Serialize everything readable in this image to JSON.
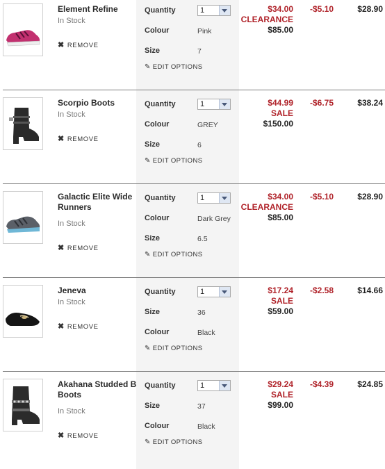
{
  "colors": {
    "sale_red": "#b0232a",
    "band_gray": "#f4f4f4"
  },
  "remove_label": "REMOVE",
  "edit_label": "EDIT OPTIONS",
  "items": [
    {
      "name": "Element Refine",
      "stock": "In Stock",
      "thumbnail": "pink-running-shoe",
      "detail1_label": "Colour",
      "detail1_value": "Pink",
      "detail2_label": "Size",
      "detail2_value": "7",
      "quantity_label": "Quantity",
      "quantity": "1",
      "sale_price": "$34.00",
      "sale_tag": "CLEARANCE",
      "original_price": "$85.00",
      "discount": "-$5.10",
      "total": "$28.90"
    },
    {
      "name": "Scorpio Boots",
      "stock": "In Stock",
      "thumbnail": "black-ankle-boot",
      "detail1_label": "Colour",
      "detail1_value": "GREY",
      "detail2_label": "Size",
      "detail2_value": "6",
      "quantity_label": "Quantity",
      "quantity": "1",
      "sale_price": "$44.99",
      "sale_tag": "SALE",
      "original_price": "$150.00",
      "discount": "-$6.75",
      "total": "$38.24"
    },
    {
      "name": "Galactic Elite Wide Runners",
      "stock": "In Stock",
      "thumbnail": "grey-running-shoe",
      "detail1_label": "Colour",
      "detail1_value": "Dark Grey",
      "detail2_label": "Size",
      "detail2_value": "6.5",
      "quantity_label": "Quantity",
      "quantity": "1",
      "sale_price": "$34.00",
      "sale_tag": "CLEARANCE",
      "original_price": "$85.00",
      "discount": "-$5.10",
      "total": "$28.90"
    },
    {
      "name": "Jeneva",
      "stock": "In Stock",
      "thumbnail": "black-flat-shoe",
      "detail1_label": "Size",
      "detail1_value": "36",
      "detail2_label": "Colour",
      "detail2_value": "Black",
      "quantity_label": "Quantity",
      "quantity": "1",
      "sale_price": "$17.24",
      "sale_tag": "SALE",
      "original_price": "$59.00",
      "discount": "-$2.58",
      "total": "$14.66"
    },
    {
      "name": "Akahana Studded B Boots",
      "stock": "In Stock",
      "thumbnail": "black-studded-boot",
      "detail1_label": "Size",
      "detail1_value": "37",
      "detail2_label": "Colour",
      "detail2_value": "Black",
      "quantity_label": "Quantity",
      "quantity": "1",
      "sale_price": "$29.24",
      "sale_tag": "SALE",
      "original_price": "$99.00",
      "discount": "-$4.39",
      "total": "$24.85"
    }
  ]
}
